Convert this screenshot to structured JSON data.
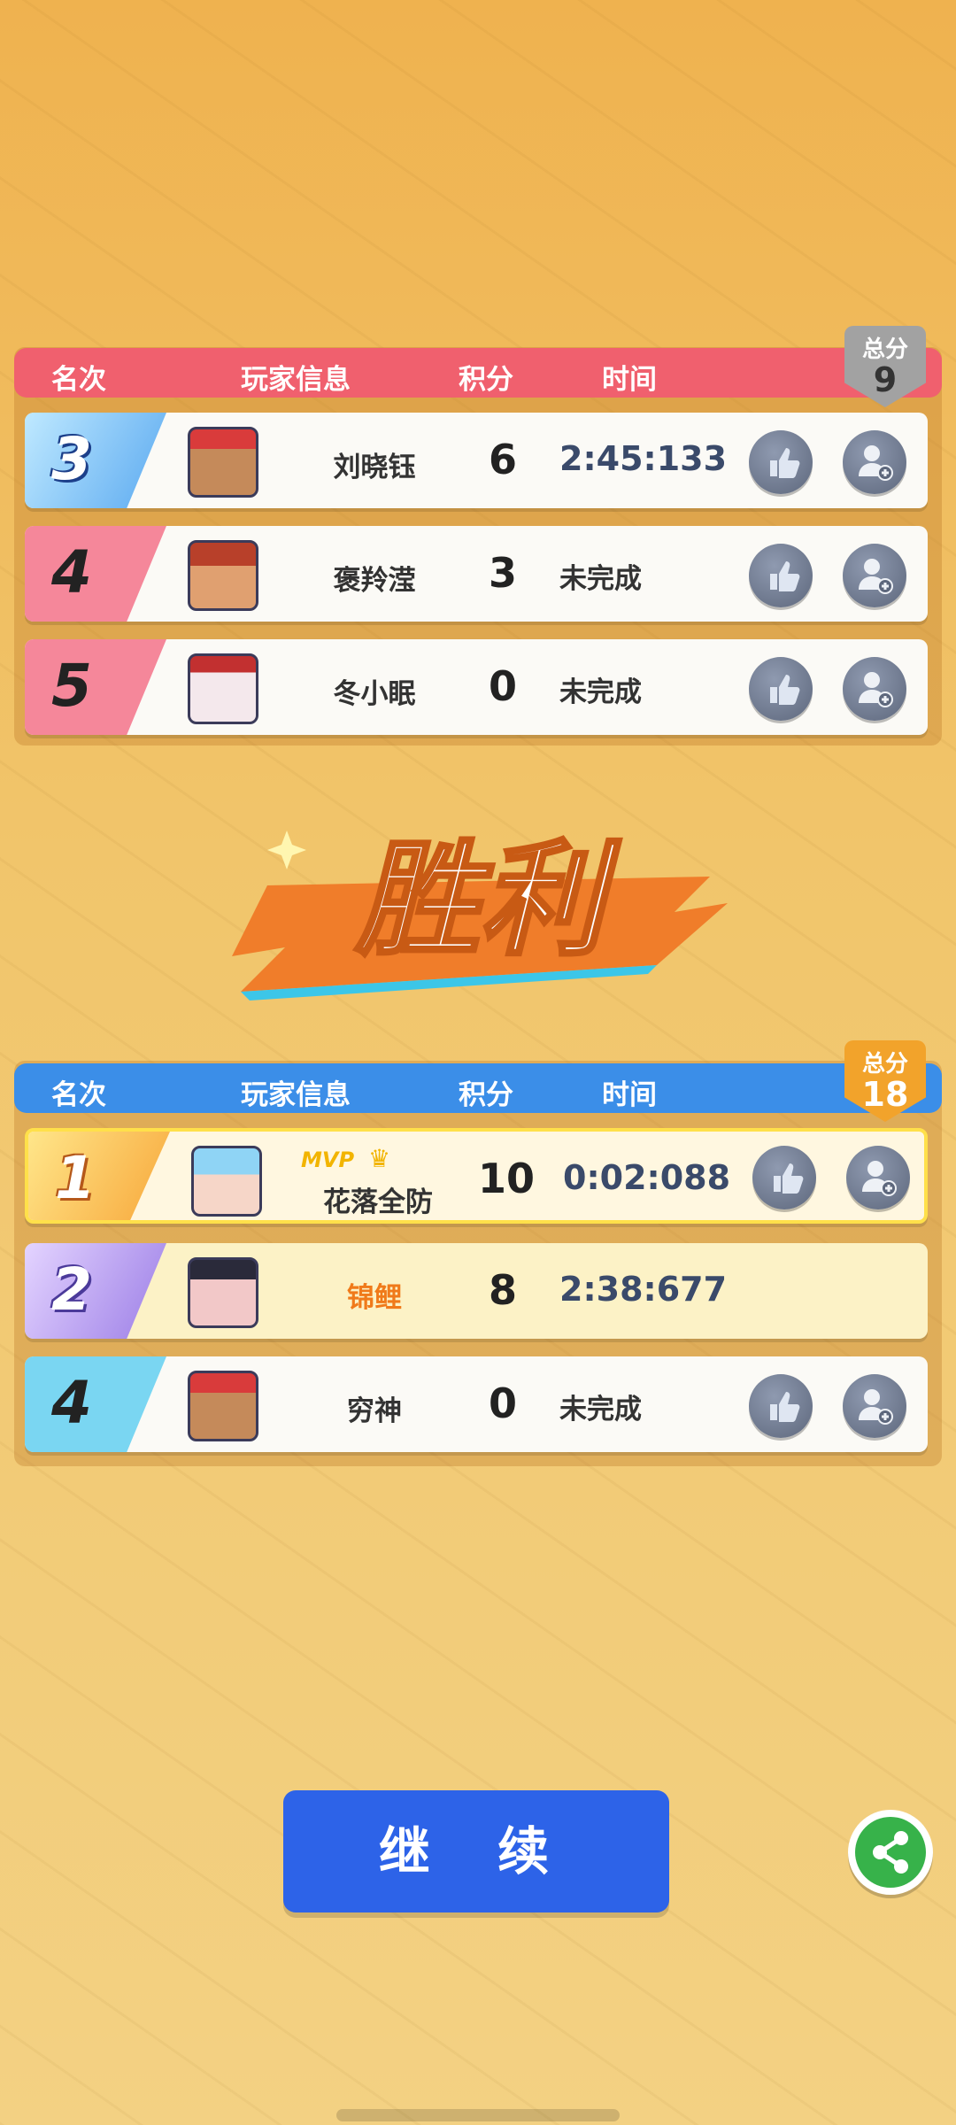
{
  "colors": {
    "red_team": "#f0606e",
    "blue_team": "#3b8ee8",
    "continue": "#2d63e8",
    "mvp": "#f2b400"
  },
  "red_team": {
    "headers": {
      "rank": "名次",
      "player": "玩家信息",
      "score": "积分",
      "time": "时间"
    },
    "total_label": "总分",
    "total": "9",
    "players": [
      {
        "rank": "3",
        "name": "刘晓钰",
        "score": "6",
        "time": "2:45:133"
      },
      {
        "rank": "4",
        "name": "褒羚滢",
        "score": "3",
        "time": "未完成"
      },
      {
        "rank": "5",
        "name": "冬小眠",
        "score": "0",
        "time": "未完成"
      }
    ]
  },
  "victory": {
    "text": "胜利"
  },
  "blue_team": {
    "headers": {
      "rank": "名次",
      "player": "玩家信息",
      "score": "积分",
      "time": "时间"
    },
    "total_label": "总分",
    "total": "18",
    "players": [
      {
        "rank": "1",
        "mvp": "MVP",
        "name": "花落全防",
        "score": "10",
        "time": "0:02:088"
      },
      {
        "rank": "2",
        "name": "锦鲤",
        "score": "8",
        "time": "2:38:677"
      },
      {
        "rank": "4",
        "name": "穷神",
        "score": "0",
        "time": "未完成"
      }
    ]
  },
  "actions": {
    "continue": "继 续"
  },
  "icons": [
    "thumbs-up-icon",
    "add-friend-icon",
    "share-icon",
    "crown-icon"
  ]
}
